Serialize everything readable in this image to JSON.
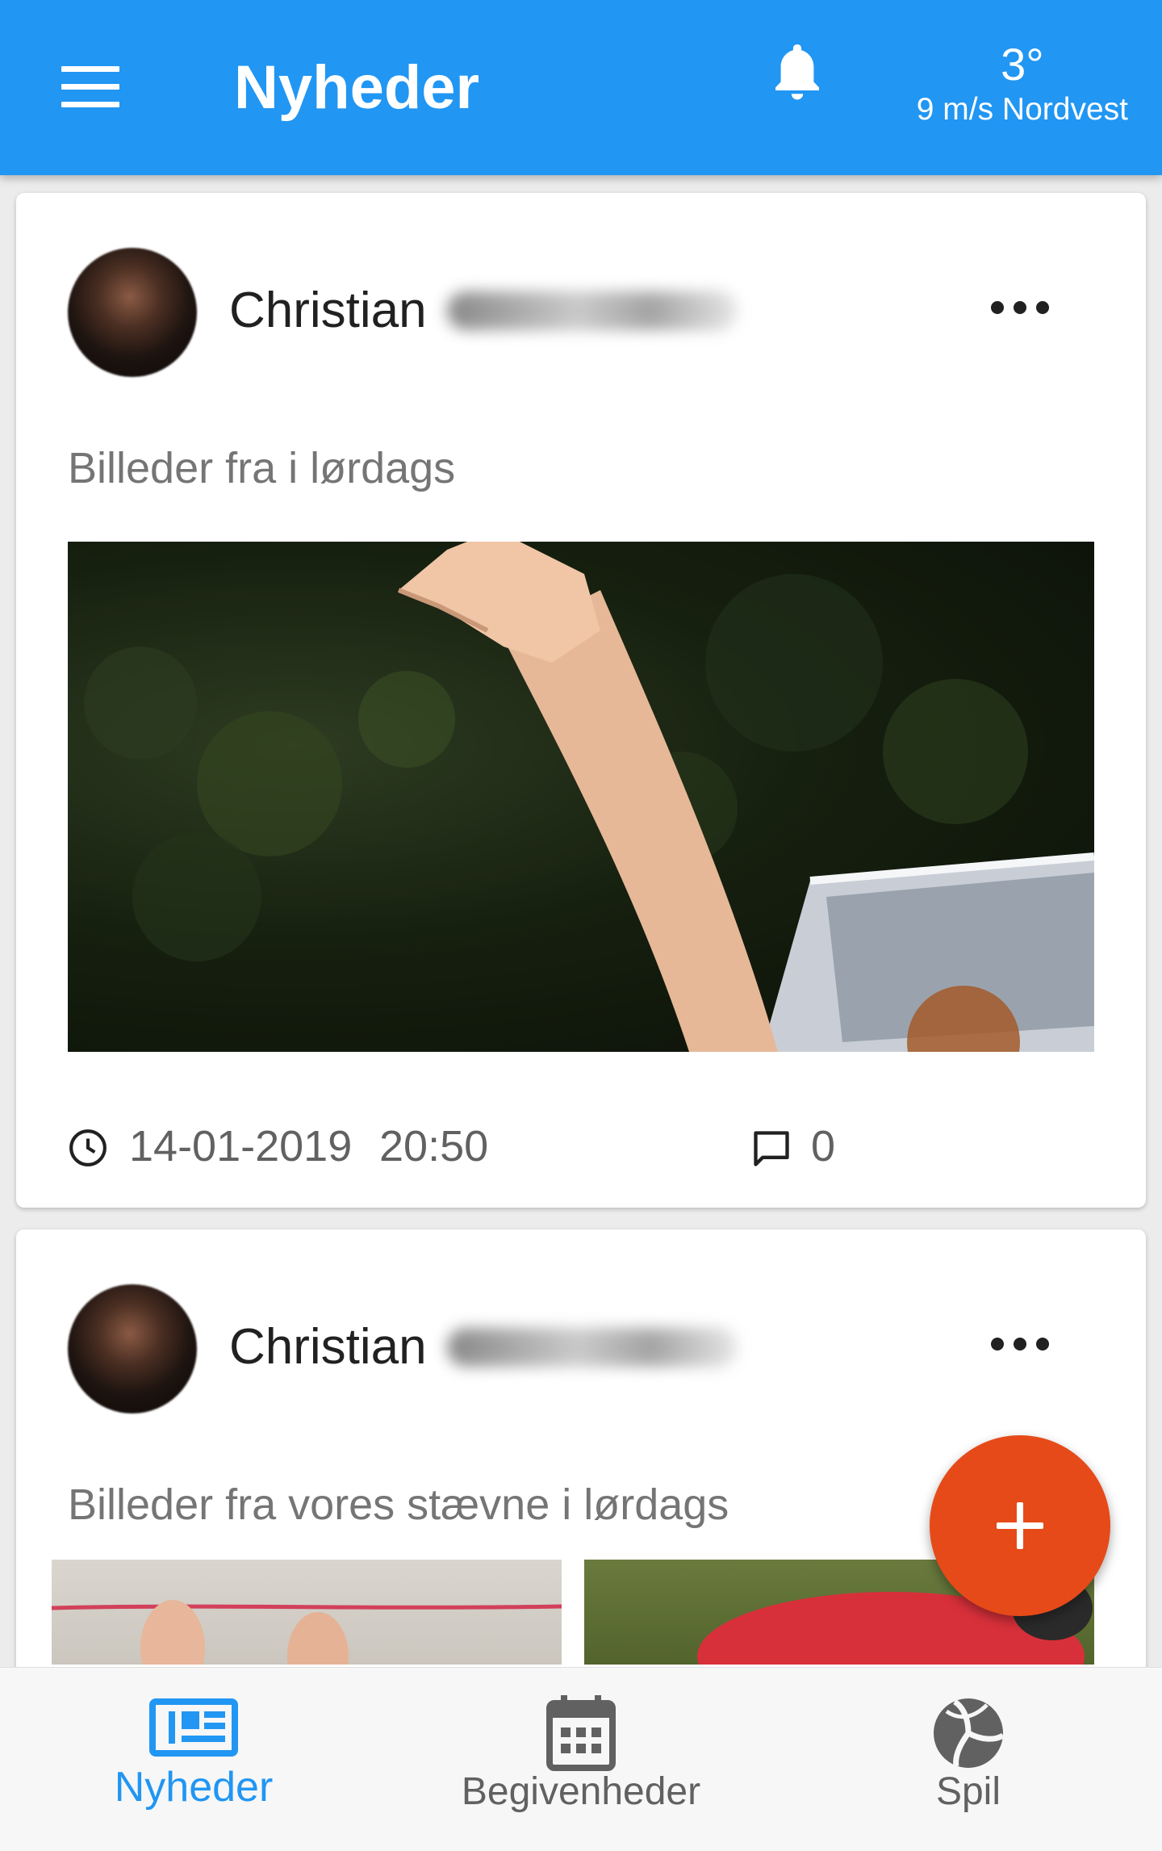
{
  "app_bar": {
    "title": "Nyheder",
    "weather": {
      "temperature": "3°",
      "wind": "9 m/s Nordvest"
    },
    "colors": {
      "background": "#2196f3",
      "text": "#ffffff"
    },
    "icons": [
      "menu-icon",
      "bell-icon"
    ]
  },
  "posts": [
    {
      "author": "Christian",
      "author_surname_visible": false,
      "text": "Billeder fra i lørdags",
      "date": "14-01-2019",
      "time": "20:50",
      "comment_count": "0"
    },
    {
      "author": "Christian",
      "author_surname_visible": false,
      "text": "Billeder fra vores stævne i lørdags"
    }
  ],
  "fab": {
    "icon": "plus-icon",
    "color": "#e64a19"
  },
  "bottom_nav": {
    "items": [
      {
        "label": "Nyheder",
        "icon": "newspaper-icon",
        "active": true
      },
      {
        "label": "Begivenheder",
        "icon": "calendar-icon",
        "active": false
      },
      {
        "label": "Spil",
        "icon": "volleyball-icon",
        "active": false
      }
    ],
    "active_color": "#2196f3",
    "inactive_color": "#616161"
  }
}
